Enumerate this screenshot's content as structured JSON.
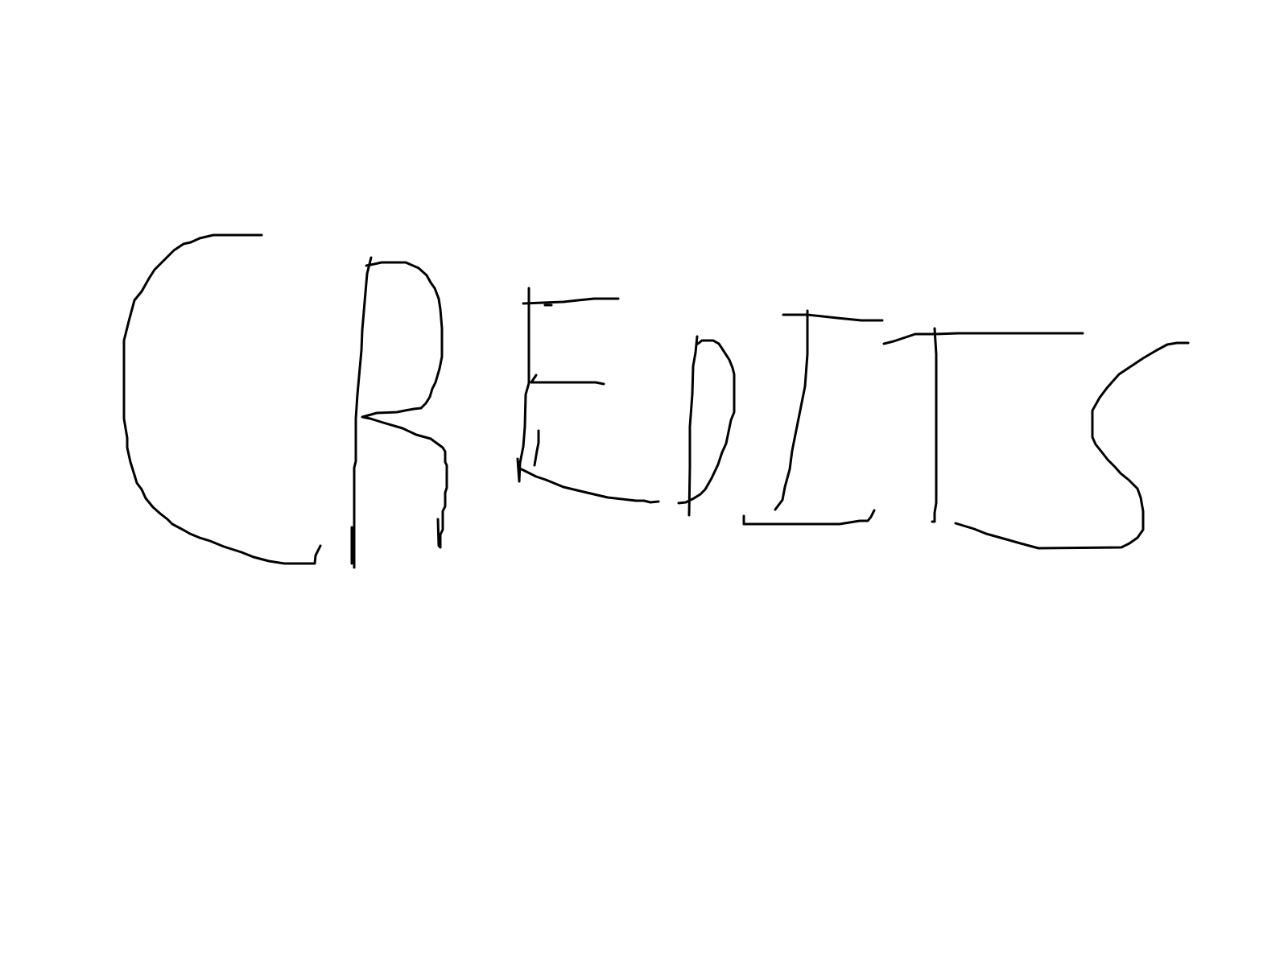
{
  "drawing": {
    "handwritten_text": "CREDITS",
    "letters": [
      "C",
      "R",
      "E",
      "D",
      "I",
      "T",
      "S"
    ],
    "ink_color": "#000000",
    "background_color": "#ffffff"
  }
}
